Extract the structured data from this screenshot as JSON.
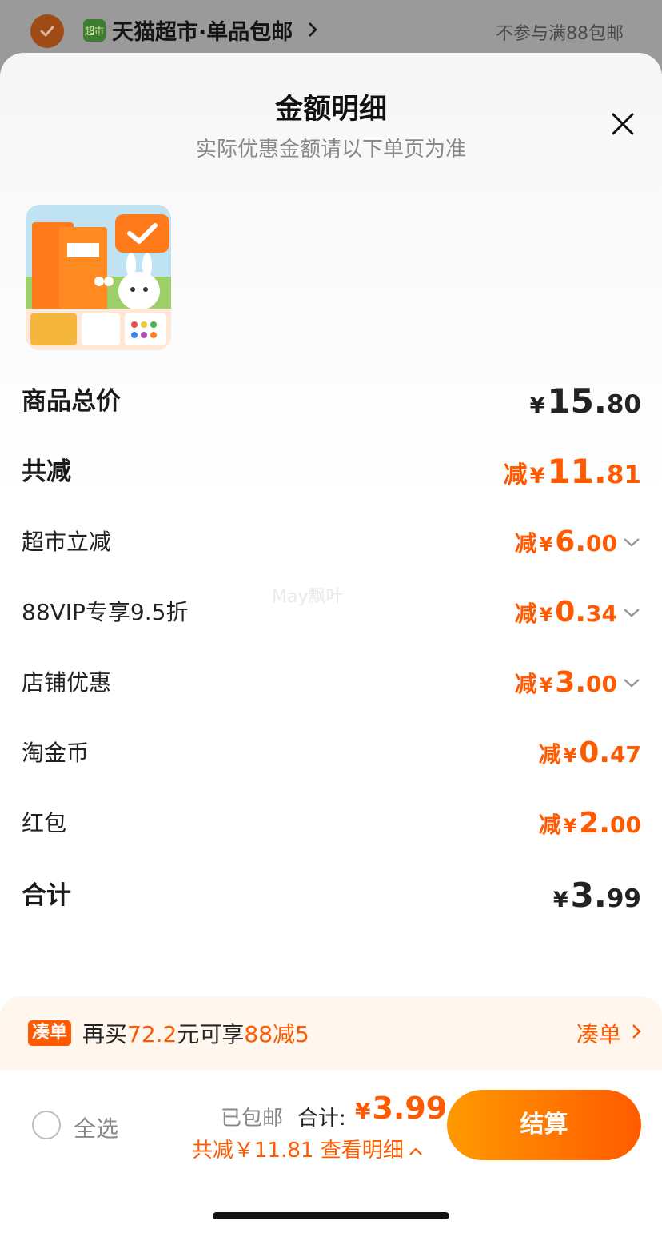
{
  "background": {
    "store_logo_text": "超市",
    "store_name": "天猫超市·单品包邮",
    "store_note": "不参与满88包邮"
  },
  "sheet": {
    "title": "金额明细",
    "subtitle": "实际优惠金额请以下单页为准",
    "watermark": "May飘叶",
    "product_image": "product-thumbnail (orange clay toy package with white bunny)"
  },
  "rows": {
    "goods_total": {
      "label": "商品总价",
      "yen": "¥",
      "int": "15.",
      "dec": "80"
    },
    "total_reduction": {
      "label": "共减",
      "prefix": "减",
      "yen": "¥",
      "int": "11.",
      "dec": "81"
    },
    "supermarket_discount": {
      "label": "超市立减",
      "prefix": "减",
      "yen": "¥",
      "int": "6.",
      "dec": "00"
    },
    "vip_discount": {
      "label": "88VIP专享9.5折",
      "prefix": "减",
      "yen": "¥",
      "int": "0.",
      "dec": "34"
    },
    "store_discount": {
      "label": "店铺优惠",
      "prefix": "减",
      "yen": "¥",
      "int": "3.",
      "dec": "00"
    },
    "tao_coins": {
      "label": "淘金币",
      "prefix": "减",
      "yen": "¥",
      "int": "0.",
      "dec": "47"
    },
    "red_packet": {
      "label": "红包",
      "prefix": "减",
      "yen": "¥",
      "int": "2.",
      "dec": "00"
    },
    "grand_total": {
      "label": "合计",
      "yen": "¥",
      "int": "3.",
      "dec": "99"
    }
  },
  "promo": {
    "tag": "凑单",
    "text_pre": "再买",
    "amount": "72.2",
    "text_mid": "元可享",
    "offer": "88减5",
    "link": "凑单"
  },
  "bottom": {
    "select_all": "全选",
    "shipping": "已包邮",
    "total_label": "合计:",
    "total_yen": "¥",
    "total_value": "3.99",
    "savings": "共减￥11.81 查看明细",
    "checkout": "结算"
  },
  "colors": {
    "accent": "#ff5a00",
    "checkout_gradient_start": "#ff9a00",
    "checkout_gradient_end": "#ff5a00",
    "promo_bg": "#fff6ee"
  }
}
